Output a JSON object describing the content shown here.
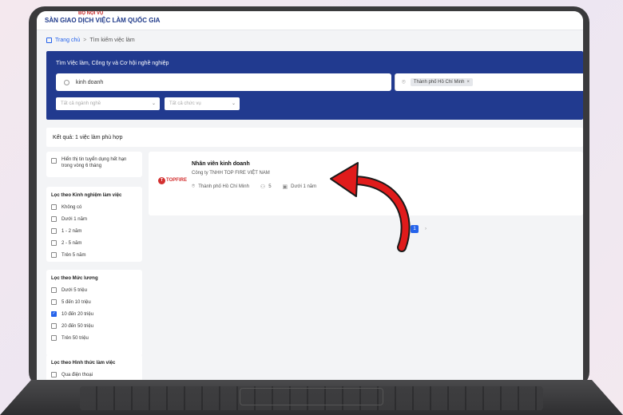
{
  "header": {
    "ministry": "BỘ NỘI VỤ",
    "site_title": "SÀN GIAO DỊCH VIỆC LÀM QUỐC GIA"
  },
  "breadcrumb": {
    "home": "Trang chủ",
    "separator": ">",
    "current": "Tìm kiếm việc làm"
  },
  "search": {
    "banner_title": "Tìm Việc làm, Công ty và Cơ hội nghề nghiệp",
    "keyword_value": "kinh doanh",
    "location_chip": "Thành phố Hồ Chí Minh",
    "location_chip_remove": "×",
    "industry_placeholder": "Tất cả ngành nghề",
    "position_placeholder": "Tất cả chức vụ"
  },
  "results": {
    "summary": "Kết quả: 1 việc làm phù hợp"
  },
  "filters": {
    "expired_label": "Hiển thị tin tuyển dụng hết hạn trong vòng 6 tháng",
    "experience": {
      "title": "Lọc theo Kinh nghiệm làm việc",
      "options": [
        "Không có",
        "Dưới 1 năm",
        "1 - 2 năm",
        "2 - 5 năm",
        "Trên 5 năm"
      ]
    },
    "salary": {
      "title": "Lọc theo Mức lương",
      "options": [
        "Dưới 5 triệu",
        "5 đến 10 triệu",
        "10 đến 20 triệu",
        "20 đến 50 triệu",
        "Trên 50 triệu"
      ],
      "checked_index": 2
    },
    "method": {
      "title": "Lọc theo Hình thức làm việc",
      "options": [
        "Qua điện thoại"
      ]
    }
  },
  "job": {
    "title": "Nhân viên kinh doanh",
    "company": "Công ty TNHH TOP FIRE VIỆT NAM",
    "location": "Thành phố Hồ Chí Minh",
    "headcount": "5",
    "experience": "Dưới 1 năm",
    "logo_text": "TOPFIRE",
    "logo_letter": "T"
  },
  "pagination": {
    "current_page": "1",
    "next": "›"
  },
  "colors": {
    "banner": "#213a8f",
    "accent": "#2563eb",
    "arrow": "#e01b1b"
  }
}
